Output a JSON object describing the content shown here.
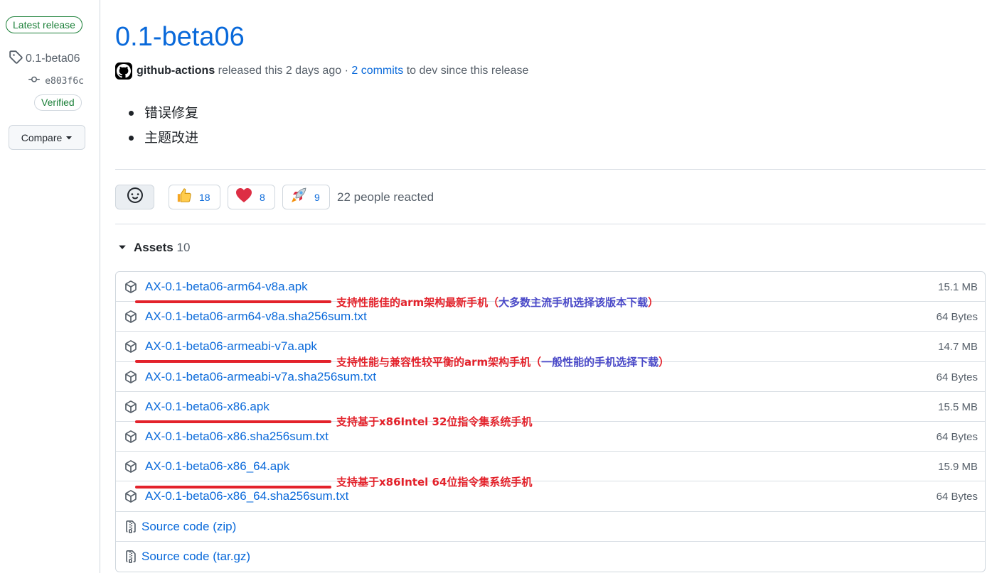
{
  "sidebar": {
    "latest_badge": "Latest release",
    "tag": "0.1-beta06",
    "commit": "e803f6c",
    "verified": "Verified",
    "compare": "Compare"
  },
  "release": {
    "title": "0.1-beta06",
    "author": "github-actions",
    "released_text": "released this 2 days ago ·",
    "commits_link": "2 commits",
    "commits_suffix": "to dev since this release",
    "notes": [
      "错误修复",
      "主题改进"
    ]
  },
  "reactions": {
    "items": [
      {
        "icon": "thumbs-up-icon",
        "count": "18"
      },
      {
        "icon": "heart-icon",
        "count": "8"
      },
      {
        "icon": "rocket-icon",
        "count": "9"
      }
    ],
    "summary": "22 people reacted"
  },
  "assets": {
    "label": "Assets",
    "count": "10",
    "files": [
      {
        "name": "AX-0.1-beta06-arm64-v8a.apk",
        "size": "15.1 MB"
      },
      {
        "name": "AX-0.1-beta06-arm64-v8a.sha256sum.txt",
        "size": "64 Bytes"
      },
      {
        "name": "AX-0.1-beta06-armeabi-v7a.apk",
        "size": "14.7 MB"
      },
      {
        "name": "AX-0.1-beta06-armeabi-v7a.sha256sum.txt",
        "size": "64 Bytes"
      },
      {
        "name": "AX-0.1-beta06-x86.apk",
        "size": "15.5 MB"
      },
      {
        "name": "AX-0.1-beta06-x86.sha256sum.txt",
        "size": "64 Bytes"
      },
      {
        "name": "AX-0.1-beta06-x86_64.apk",
        "size": "15.9 MB"
      },
      {
        "name": "AX-0.1-beta06-x86_64.sha256sum.txt",
        "size": "64 Bytes"
      }
    ],
    "source": [
      {
        "label": "Source code",
        "format": "(zip)"
      },
      {
        "label": "Source code",
        "format": "(tar.gz)"
      }
    ]
  },
  "annotations": [
    {
      "red": "支持性能佳的arm架构最新手机（",
      "blue": "大多数主流手机选择该版本下载",
      "close": "）"
    },
    {
      "red": "支持性能与兼容性较平衡的arm架构手机（",
      "blue": "一般性能的手机选择下载",
      "close": "）"
    },
    {
      "red": "支持基于x86Intel 32位指令集系统手机",
      "blue": "",
      "close": ""
    },
    {
      "red": "支持基于x86Intel 64位指令集系统手机",
      "blue": "",
      "close": ""
    }
  ],
  "colors": {
    "link": "#0969da",
    "green": "#1a7f37",
    "annotation_red": "#e3222b",
    "annotation_blue": "#4a49c8"
  }
}
